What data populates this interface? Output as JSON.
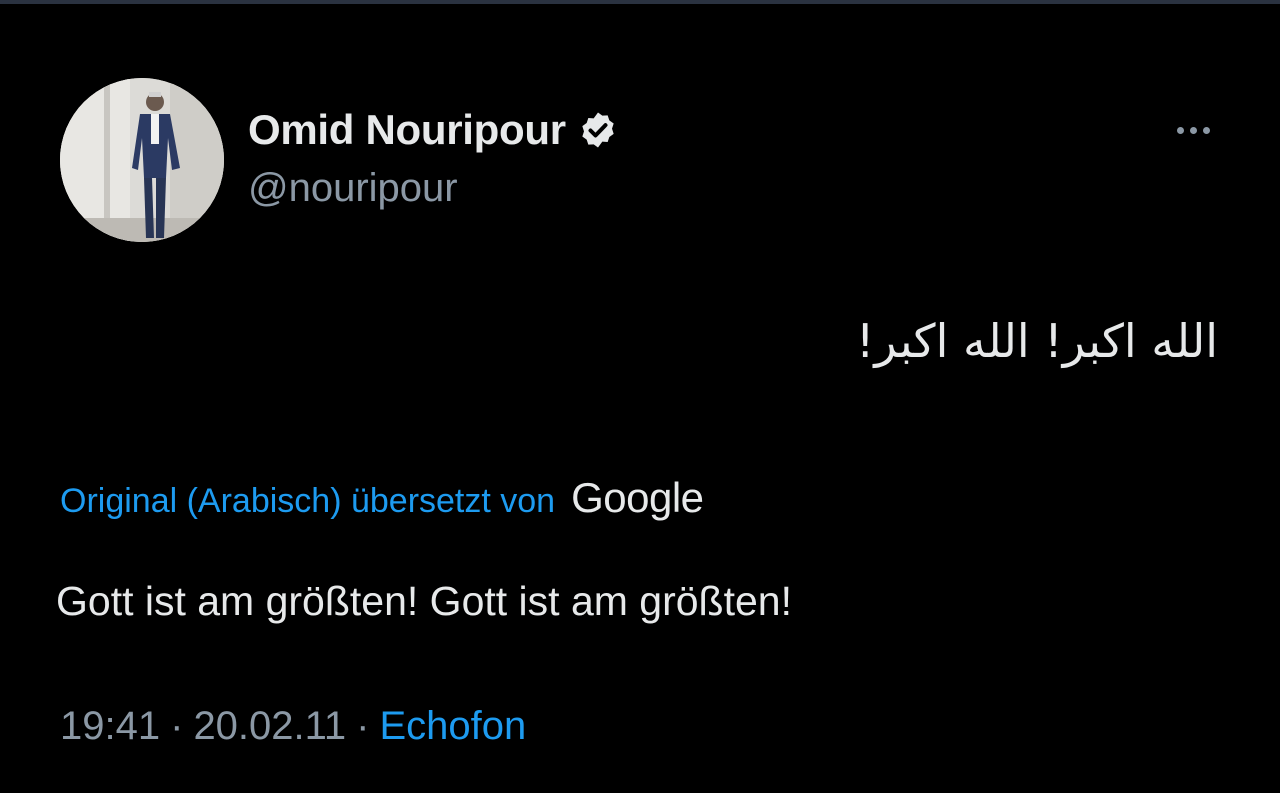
{
  "tweet": {
    "author": {
      "display_name": "Omid Nouripour",
      "handle": "@nouripour",
      "verified_icon": "verified-badge-icon",
      "avatar_icon": "profile-photo"
    },
    "more_icon": "more-options-icon",
    "original_text": "الله اكبر! الله اكبر!",
    "translation": {
      "label": "Original (Arabisch) übersetzt von",
      "provider": "Google"
    },
    "translated_text": "Gott ist am größten! Gott ist am größten!",
    "meta": {
      "time": "19:41",
      "separator": "·",
      "date": "20.02.11",
      "source": "Echofon"
    }
  },
  "colors": {
    "background": "#000000",
    "text_primary": "#e7e9ea",
    "text_secondary": "#8b98a5",
    "accent": "#1d9bf0"
  }
}
